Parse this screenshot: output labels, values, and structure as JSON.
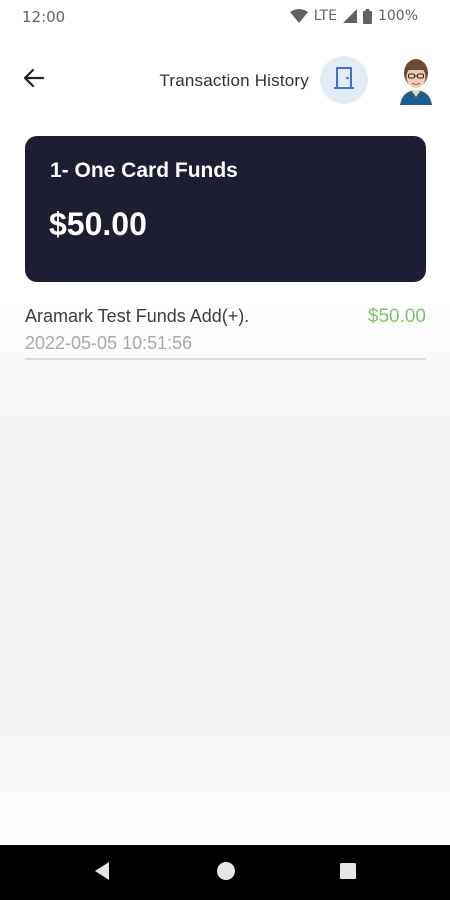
{
  "status_bar": {
    "time": "12:00",
    "network": "LTE",
    "battery": "100%"
  },
  "header": {
    "title": "Transaction History",
    "back_icon": "arrow-left-icon",
    "exit_icon": "door-icon"
  },
  "card": {
    "title": "1- One Card Funds",
    "amount": "$50.00"
  },
  "transactions": [
    {
      "description": "Aramark Test Funds Add(+).",
      "date": "2022-05-05 10:51:56",
      "amount": "$50.00"
    }
  ],
  "colors": {
    "card_background": "#1e1e33",
    "positive_amount": "#7cc46a",
    "exit_button_bg": "#e3ebf7"
  }
}
